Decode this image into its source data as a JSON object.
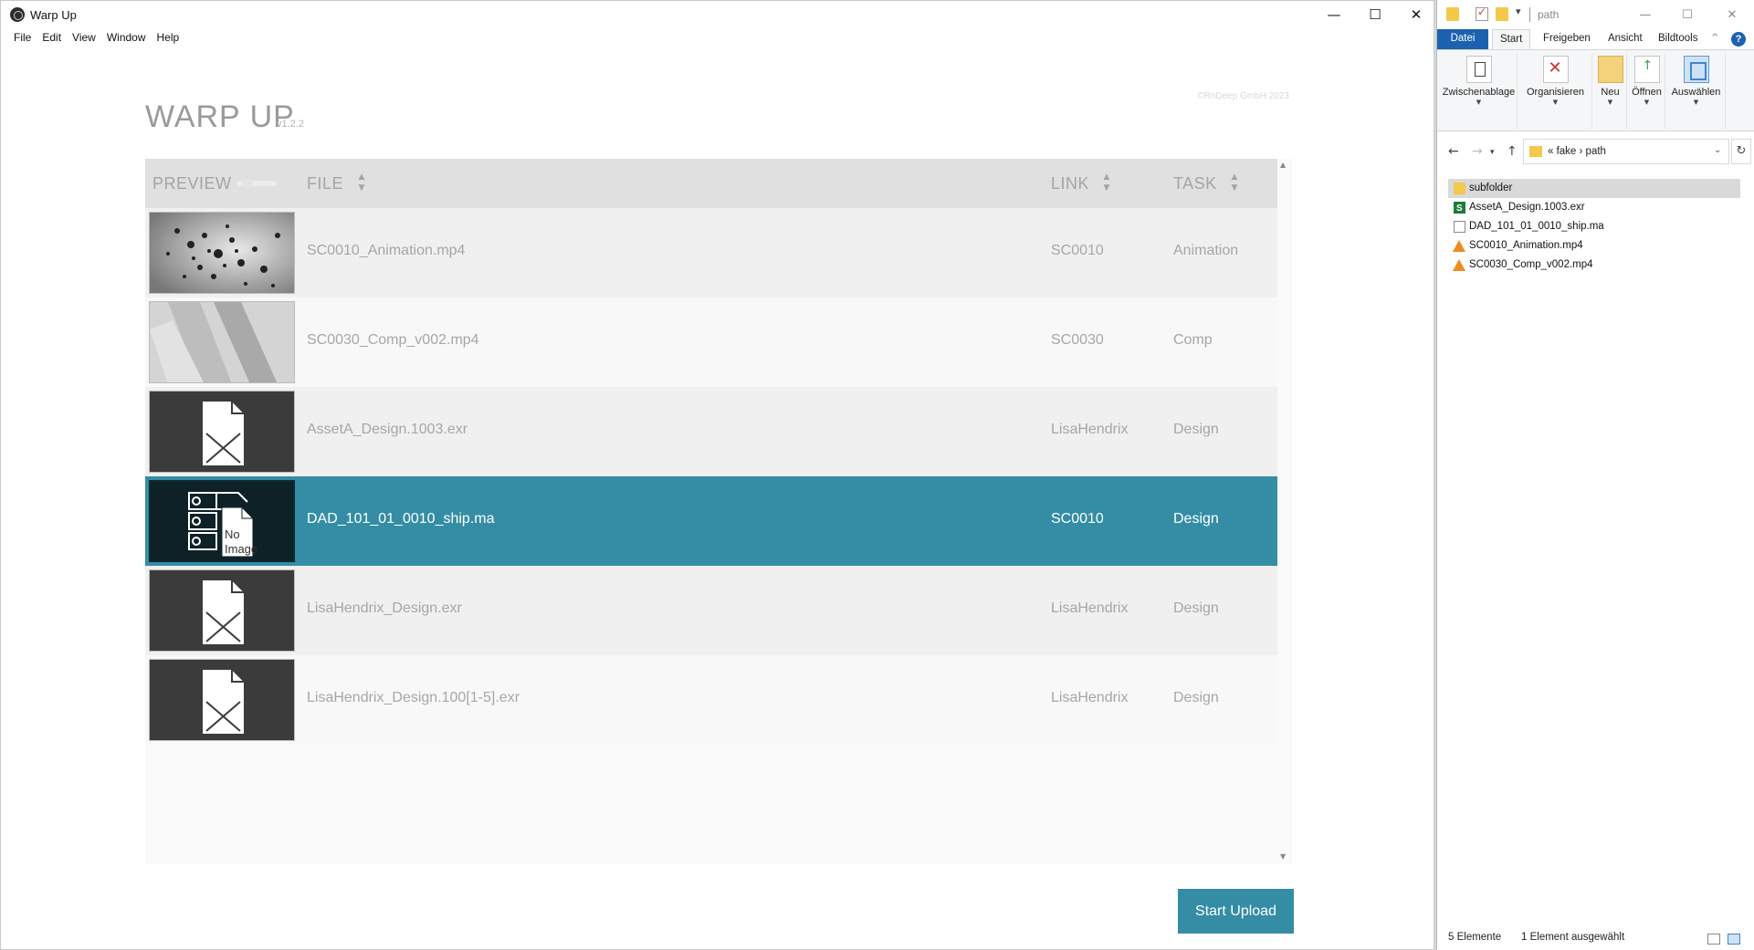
{
  "app": {
    "window_title": "Warp Up",
    "menu": [
      "File",
      "Edit",
      "View",
      "Window",
      "Help"
    ],
    "brand": "WARP UP",
    "version": "v1.2.2",
    "copyright": "©RnDeep GmbH 2023",
    "columns": {
      "preview": "PREVIEW",
      "file": "FILE",
      "link": "LINK",
      "task": "TASK"
    },
    "rows": [
      {
        "file": "SC0010_Animation.mp4",
        "link": "SC0010",
        "task": "Animation",
        "thumb": "particles"
      },
      {
        "file": "SC0030_Comp_v002.mp4",
        "link": "SC0030",
        "task": "Comp",
        "thumb": "stripes"
      },
      {
        "file": "AssetA_Design.1003.exr",
        "link": "LisaHendrix",
        "task": "Design",
        "thumb": "broken-file"
      },
      {
        "file": "DAD_101_01_0010_ship.ma",
        "link": "SC0010",
        "task": "Design",
        "thumb": "no-image",
        "selected": true
      },
      {
        "file": "LisaHendrix_Design.exr",
        "link": "LisaHendrix",
        "task": "Design",
        "thumb": "broken-file"
      },
      {
        "file": "LisaHendrix_Design.100[1-5].exr",
        "link": "LisaHendrix",
        "task": "Design",
        "thumb": "broken-file"
      }
    ],
    "no_image_text": [
      "No",
      "Image"
    ],
    "upload_button": "Start Upload",
    "accent_color": "#348da5"
  },
  "explorer": {
    "title": "path",
    "tabs": [
      "Datei",
      "Start",
      "Freigeben",
      "Ansicht",
      "Bildtools"
    ],
    "ribbon": [
      "Zwischenablage",
      "Organisieren",
      "Neu",
      "Öffnen",
      "Auswählen"
    ],
    "address": "«  fake  ›  path",
    "files": [
      {
        "name": "subfolder",
        "icon": "folder-icon",
        "selected": true
      },
      {
        "name": "AssetA_Design.1003.exr",
        "icon": "exr-file-icon"
      },
      {
        "name": "DAD_101_01_0010_ship.ma",
        "icon": "document-icon"
      },
      {
        "name": "SC0010_Animation.mp4",
        "icon": "vlc-file-icon"
      },
      {
        "name": "SC0030_Comp_v002.mp4",
        "icon": "vlc-file-icon"
      }
    ],
    "status_count": "5 Elemente",
    "status_selected": "1 Element ausgewählt"
  }
}
